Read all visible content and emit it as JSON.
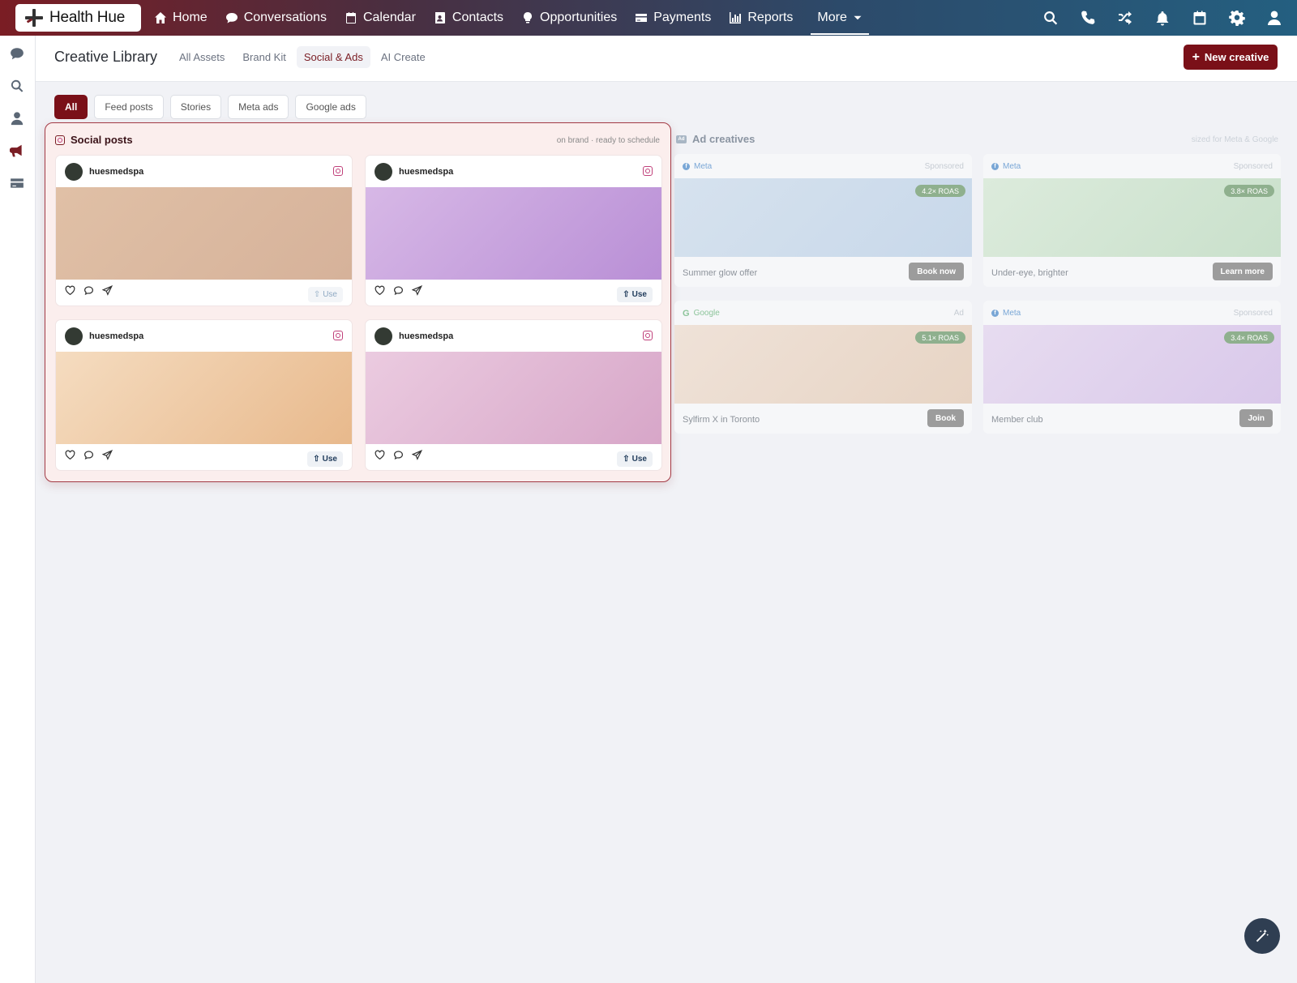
{
  "brand": {
    "name": "Health Hue",
    "icon": "health-hue-logo"
  },
  "nav": {
    "items": [
      {
        "label": "Home",
        "icon": "home-icon"
      },
      {
        "label": "Conversations",
        "icon": "chat-icon"
      },
      {
        "label": "Calendar",
        "icon": "calendar-icon"
      },
      {
        "label": "Contacts",
        "icon": "contact-card-icon"
      },
      {
        "label": "Opportunities",
        "icon": "lightbulb-icon"
      },
      {
        "label": "Payments",
        "icon": "credit-card-icon"
      },
      {
        "label": "Reports",
        "icon": "bar-chart-icon"
      },
      {
        "label": "More",
        "icon": "caret-down-icon"
      }
    ],
    "right_icons": [
      "search-icon",
      "phone-icon",
      "shuffle-icon",
      "bell-icon",
      "calendar-icon",
      "gear-icon",
      "user-icon"
    ]
  },
  "sidebar_icons": [
    "chat-icon",
    "search-icon",
    "user-icon",
    "megaphone-icon",
    "card-icon"
  ],
  "header": {
    "title": "Creative Library",
    "tabs": [
      "All Assets",
      "Brand Kit",
      "Social & Ads",
      "AI Create"
    ],
    "active_tab": "Social & Ads",
    "new_button": "New creative"
  },
  "filters": {
    "chips": [
      "All",
      "Feed posts",
      "Stories",
      "Meta ads",
      "Google ads"
    ],
    "active": "All"
  },
  "social": {
    "title": "Social posts",
    "subtitle": "on brand · ready to schedule",
    "posts": [
      {
        "handle": "huesmedspa",
        "use_label": "Use"
      },
      {
        "handle": "huesmedspa",
        "use_label": "Use"
      },
      {
        "handle": "huesmedspa",
        "use_label": "Use"
      },
      {
        "handle": "huesmedspa",
        "use_label": "Use"
      }
    ]
  },
  "ads": {
    "title": "Ad creatives",
    "subtitle": "sized for Meta & Google",
    "items": [
      {
        "platform": "Meta",
        "tag": "Sponsored",
        "roas": "4.2× ROAS",
        "caption": "Summer glow offer",
        "cta": "Book now"
      },
      {
        "platform": "Meta",
        "tag": "Sponsored",
        "roas": "3.8× ROAS",
        "caption": "Under-eye, brighter",
        "cta": "Learn more"
      },
      {
        "platform": "Google",
        "tag": "Ad",
        "roas": "5.1× ROAS",
        "caption": "Sylfirm X in Toronto",
        "cta": "Book"
      },
      {
        "platform": "Meta",
        "tag": "Sponsored",
        "roas": "3.4× ROAS",
        "caption": "Member club",
        "cta": "Join"
      }
    ]
  },
  "colors": {
    "accent": "#7a1018",
    "nav_gradient_start": "#7a1d24",
    "nav_gradient_end": "#245f80",
    "panel_highlight": "#fbeeed"
  }
}
